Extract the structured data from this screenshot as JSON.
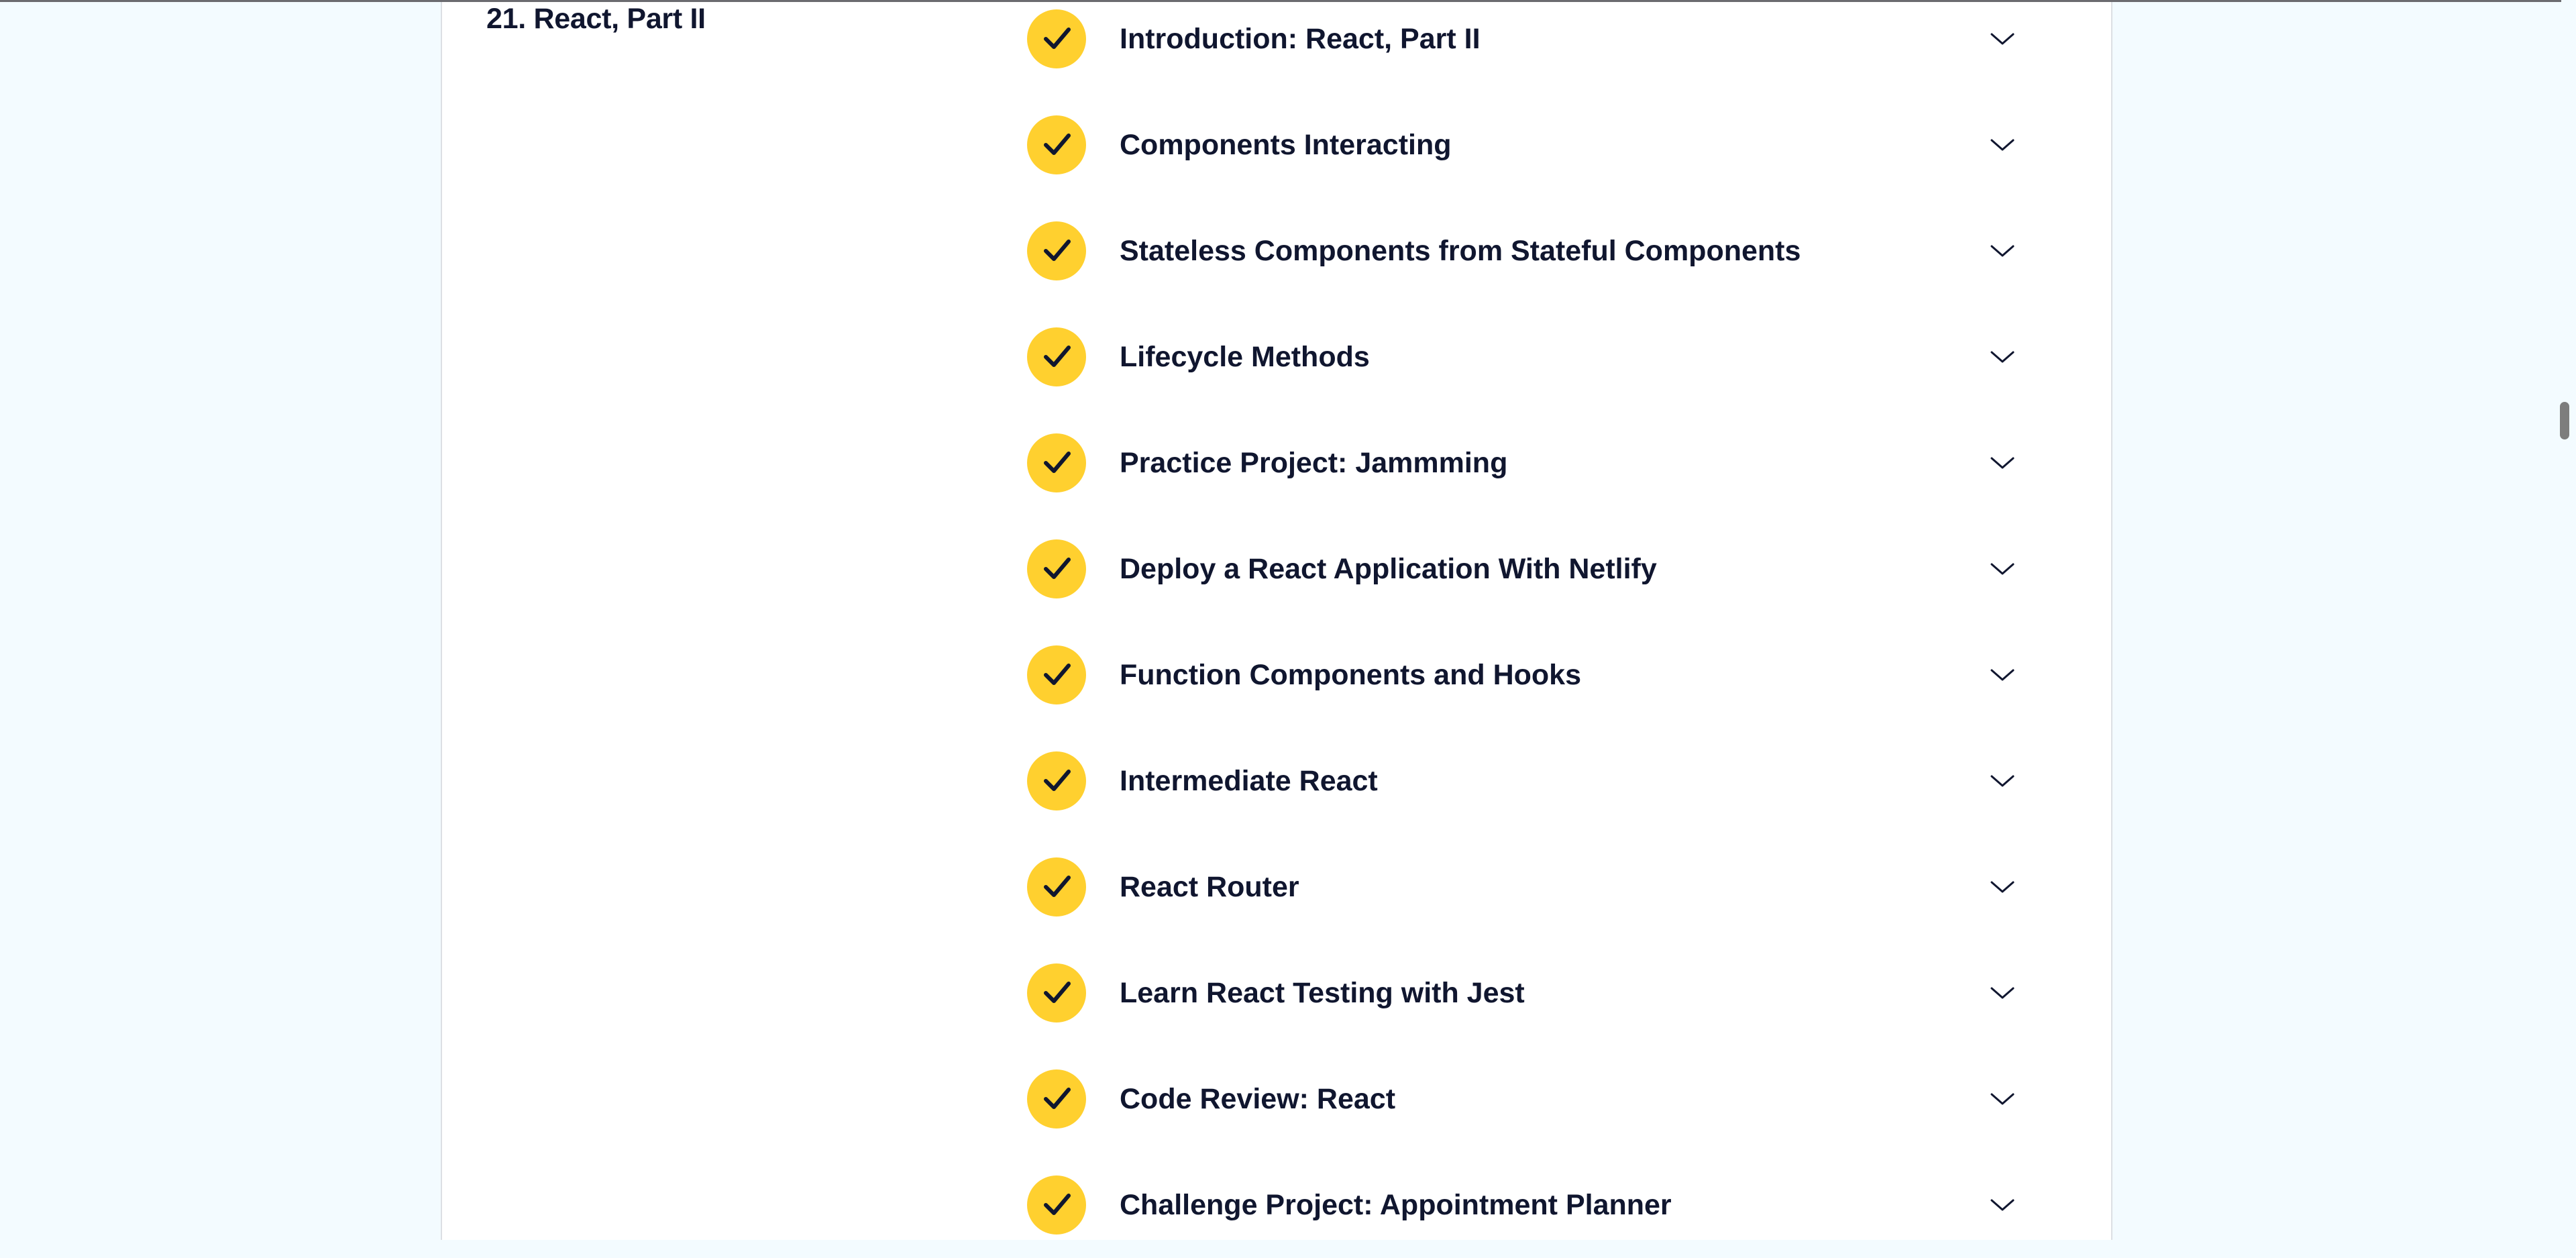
{
  "module": {
    "title": "21. React, Part II"
  },
  "lessons": [
    {
      "title": "Introduction: React, Part II",
      "completed": true
    },
    {
      "title": "Components Interacting",
      "completed": true
    },
    {
      "title": "Stateless Components from Stateful Components",
      "completed": true
    },
    {
      "title": "Lifecycle Methods",
      "completed": true
    },
    {
      "title": "Practice Project: Jammming",
      "completed": true
    },
    {
      "title": "Deploy a React Application With Netlify",
      "completed": true
    },
    {
      "title": "Function Components and Hooks",
      "completed": true
    },
    {
      "title": "Intermediate React",
      "completed": true
    },
    {
      "title": "React Router",
      "completed": true
    },
    {
      "title": "Learn React Testing with Jest",
      "completed": true
    },
    {
      "title": "Code Review: React",
      "completed": true
    },
    {
      "title": "Challenge Project: Appointment Planner",
      "completed": true
    }
  ],
  "icons": {
    "completed": "check-icon",
    "expand": "chevron-down-icon"
  },
  "colors": {
    "background": "#f3fbff",
    "card": "#ffffff",
    "text": "#10162f",
    "check_badge": "#ffd02f"
  }
}
